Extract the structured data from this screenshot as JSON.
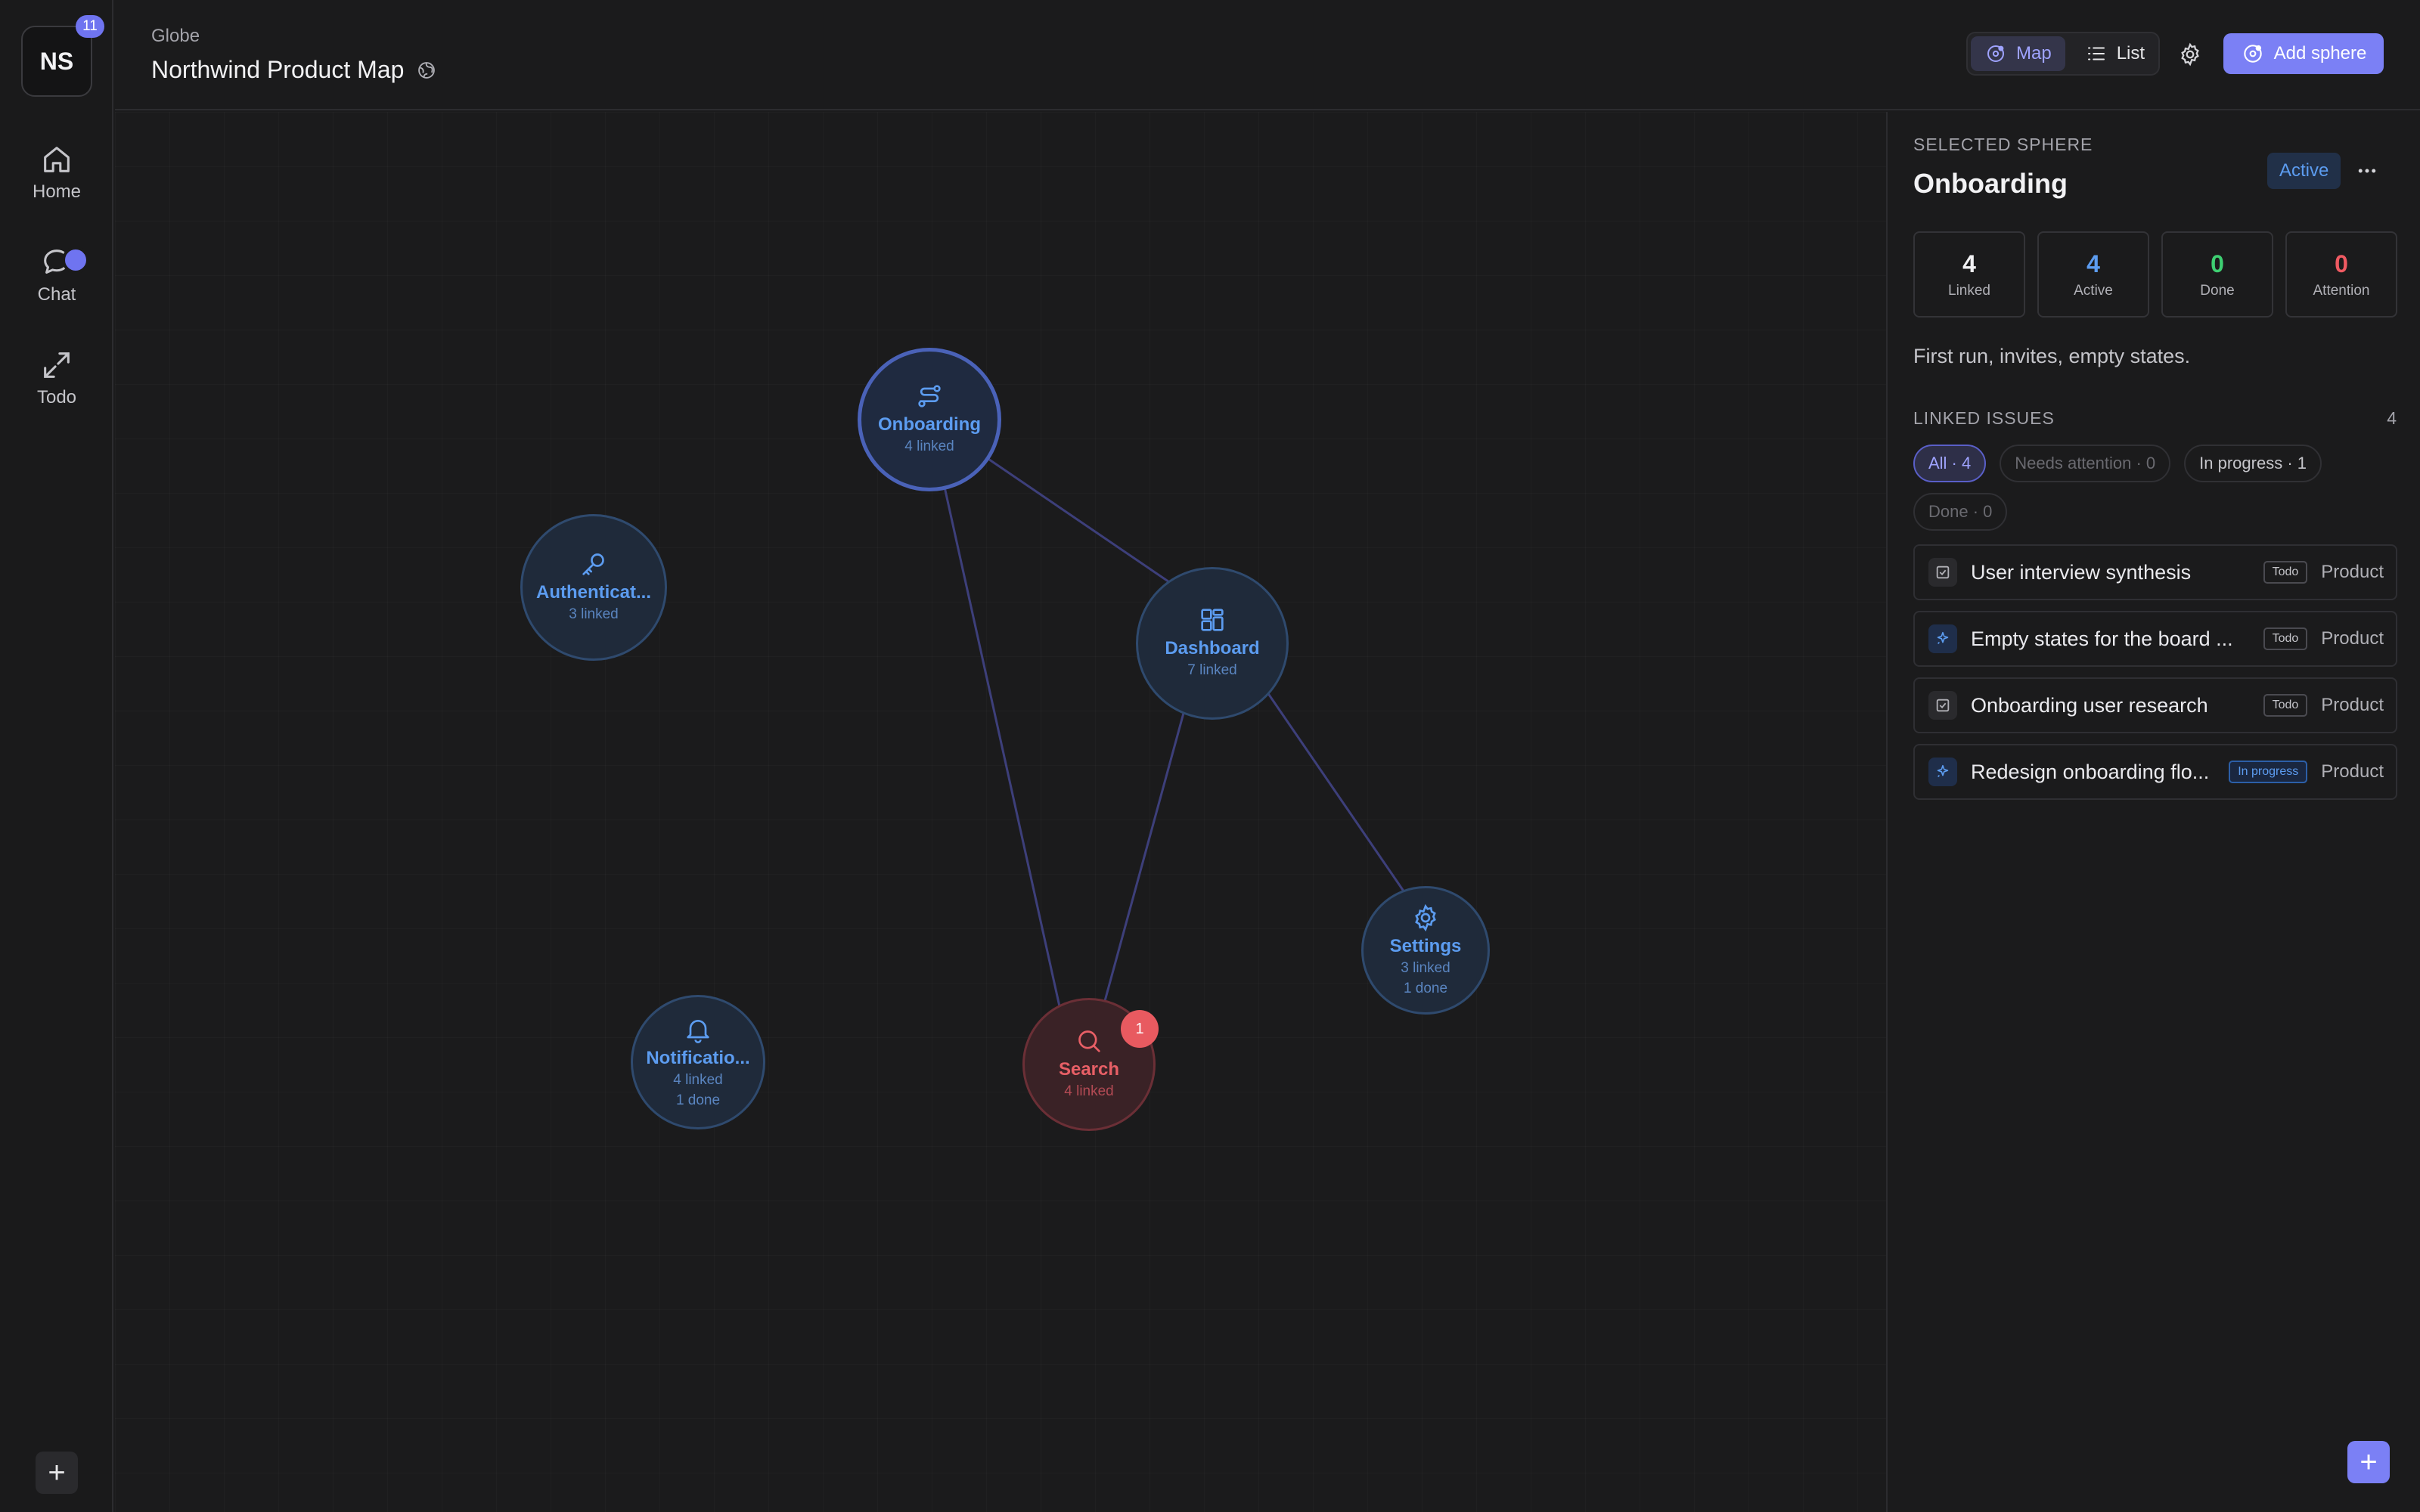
{
  "workspace": {
    "initials": "NS",
    "badge": "11"
  },
  "rail": {
    "home_label": "Home",
    "chat_label": "Chat",
    "chat_badge": "",
    "todo_label": "Todo",
    "add_label": "+"
  },
  "header": {
    "breadcrumb": "Globe",
    "title": "Northwind Product Map",
    "view_map": "Map",
    "view_list": "List",
    "active_view": "Map",
    "add_button": "Add sphere"
  },
  "map": {
    "nodes": [
      {
        "name": "Onboarding",
        "icon": "flow-icon",
        "sub1": "4 linked",
        "sub2": "",
        "selected": true
      },
      {
        "name": "Authenticat...",
        "icon": "key-icon",
        "sub1": "3 linked",
        "sub2": ""
      },
      {
        "name": "Dashboard",
        "icon": "dashboard-icon",
        "sub1": "7 linked",
        "sub2": ""
      },
      {
        "name": "Settings",
        "icon": "gear-icon",
        "sub1": "3 linked",
        "sub2": "1 done"
      },
      {
        "name": "Notificatio...",
        "icon": "bell-icon",
        "sub1": "4 linked",
        "sub2": "1 done"
      },
      {
        "name": "Search",
        "icon": "search-icon",
        "sub1": "4 linked",
        "sub2": "",
        "badge": "1",
        "status": "attention"
      }
    ]
  },
  "panel": {
    "label": "SELECTED SPHERE",
    "title": "Onboarding",
    "status": "Active",
    "stats": [
      {
        "value": "4",
        "label": "Linked",
        "color": "#f2f2f4"
      },
      {
        "value": "4",
        "label": "Active",
        "color": "#5c9cf0"
      },
      {
        "value": "0",
        "label": "Done",
        "color": "#3ecf72"
      },
      {
        "value": "0",
        "label": "Attention",
        "color": "#ef5a62"
      }
    ],
    "description": "First run, invites, empty states.",
    "section_title": "LINKED ISSUES",
    "section_count": "4",
    "filters": [
      "All · 4",
      "Needs attention · 0",
      "In progress · 1",
      "Done · 0"
    ],
    "issues": [
      {
        "title": "User interview synthesis",
        "tag": "Todo",
        "team": "Product",
        "icon": "checkbox-icon"
      },
      {
        "title": "Empty states for the board ...",
        "tag": "Todo",
        "team": "Product",
        "icon": "sparkle-icon"
      },
      {
        "title": "Onboarding user research",
        "tag": "Todo",
        "team": "Product",
        "icon": "checkbox-icon"
      },
      {
        "title": "Redesign onboarding flo...",
        "tag": "In progress",
        "team": "Product",
        "icon": "sparkle-icon"
      }
    ],
    "fab_label": "+"
  },
  "colors": {
    "accent": "#7b80f5",
    "sphere_blue": "#5c9cf0",
    "attention_red": "#e85f66",
    "done_green": "#3ecf72"
  }
}
